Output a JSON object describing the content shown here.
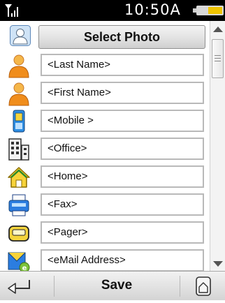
{
  "status": {
    "time": "10:50A"
  },
  "form": {
    "select_photo_label": "Select Photo",
    "fields": [
      {
        "icon": "person-icon",
        "text": "<Last Name>"
      },
      {
        "icon": "person-icon",
        "text": "<First Name>"
      },
      {
        "icon": "mobile-phone-icon",
        "text": "<Mobile >"
      },
      {
        "icon": "office-building-icon",
        "text": "<Office>"
      },
      {
        "icon": "home-icon",
        "text": "<Home>"
      },
      {
        "icon": "fax-icon",
        "text": "<Fax>"
      },
      {
        "icon": "pager-icon",
        "text": "<Pager>"
      },
      {
        "icon": "email-icon",
        "text": "<eMail Address>"
      }
    ]
  },
  "bottom": {
    "save_label": "Save"
  }
}
